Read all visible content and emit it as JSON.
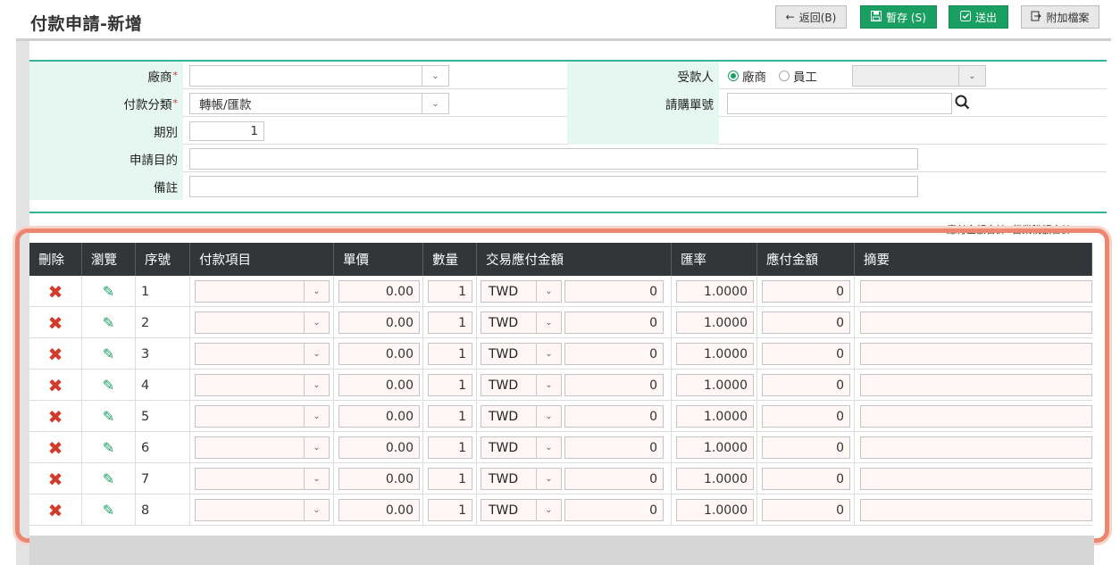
{
  "page": {
    "title": "付款申請-新增"
  },
  "toolbar": {
    "back_label": "返回(B)",
    "save_label": "暫存 (S)",
    "submit_label": "送出",
    "attach_label": "附加檔案"
  },
  "form": {
    "vendor_label": "廠商",
    "vendor_value": "",
    "payee_label": "受款人",
    "payee_options": [
      "廠商",
      "員工"
    ],
    "payee_selected": "廠商",
    "category_label": "付款分類",
    "category_value": "轉帳/匯款",
    "pr_no_label": "請購單號",
    "pr_no_value": "",
    "period_label": "期別",
    "period_value": "1",
    "purpose_label": "申請目的",
    "purpose_value": "",
    "remark_label": "備註",
    "remark_value": "",
    "required_mark": "*"
  },
  "totals": {
    "text": "應付金額合計:   營業稅額合計:"
  },
  "grid": {
    "headers": [
      "刪除",
      "瀏覽",
      "序號",
      "付款項目",
      "單價",
      "數量",
      "交易應付金額",
      "匯率",
      "應付金額",
      "摘要"
    ],
    "rows": [
      {
        "no": "1",
        "price": "0.00",
        "qty": "1",
        "currency": "TWD",
        "amount": "0",
        "rate": "1.0000",
        "payable": "0"
      },
      {
        "no": "2",
        "price": "0.00",
        "qty": "1",
        "currency": "TWD",
        "amount": "0",
        "rate": "1.0000",
        "payable": "0"
      },
      {
        "no": "3",
        "price": "0.00",
        "qty": "1",
        "currency": "TWD",
        "amount": "0",
        "rate": "1.0000",
        "payable": "0"
      },
      {
        "no": "4",
        "price": "0.00",
        "qty": "1",
        "currency": "TWD",
        "amount": "0",
        "rate": "1.0000",
        "payable": "0"
      },
      {
        "no": "5",
        "price": "0.00",
        "qty": "1",
        "currency": "TWD",
        "amount": "0",
        "rate": "1.0000",
        "payable": "0"
      },
      {
        "no": "6",
        "price": "0.00",
        "qty": "1",
        "currency": "TWD",
        "amount": "0",
        "rate": "1.0000",
        "payable": "0"
      },
      {
        "no": "7",
        "price": "0.00",
        "qty": "1",
        "currency": "TWD",
        "amount": "0",
        "rate": "1.0000",
        "payable": "0"
      },
      {
        "no": "8",
        "price": "0.00",
        "qty": "1",
        "currency": "TWD",
        "amount": "0",
        "rate": "1.0000",
        "payable": "0"
      }
    ]
  },
  "icons": {
    "delete": "close-x-icon",
    "browse": "pencil-icon",
    "search": "search-icon",
    "back": "arrow-left-icon",
    "save": "floppy-icon",
    "submit": "check-square-icon",
    "attach": "attachment-icon",
    "dropdown": "chevron-down-icon"
  },
  "colors": {
    "accent": "#1a9f62",
    "teal": "#38b39a",
    "header_bg": "#333639",
    "highlight": "#ec8670",
    "delete": "#d43a2a"
  }
}
